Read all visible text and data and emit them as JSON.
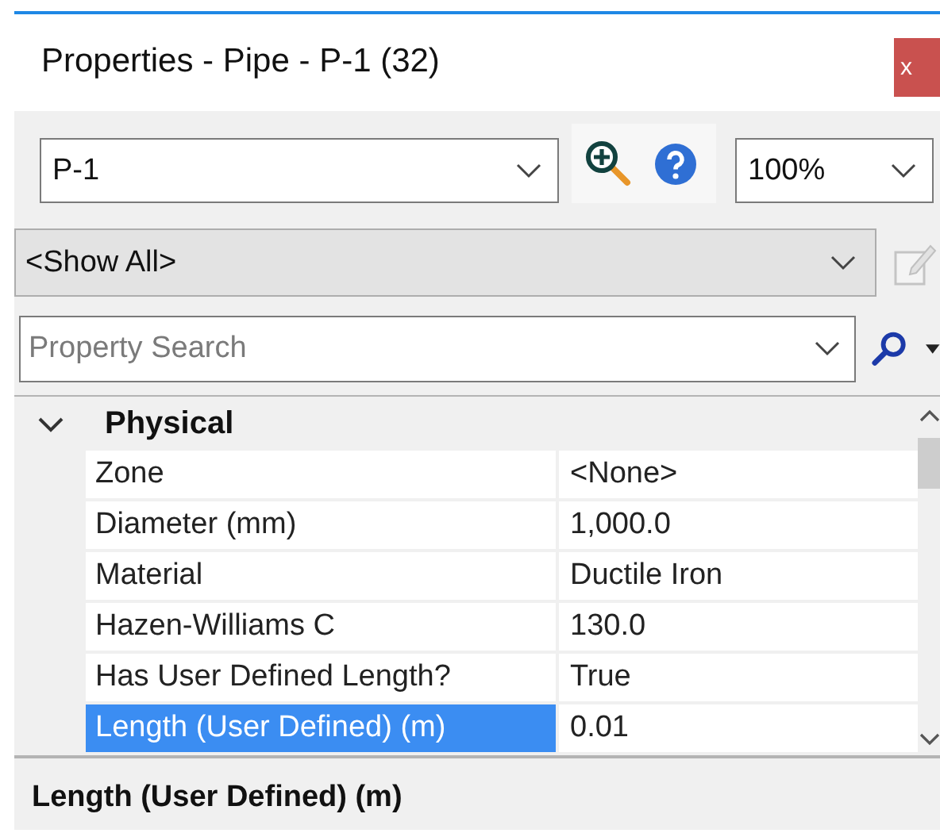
{
  "window": {
    "title": "Properties - Pipe - P-1 (32)",
    "close": "x"
  },
  "toolbar": {
    "element": {
      "value": "P-1"
    },
    "zoom": {
      "value": "100%"
    }
  },
  "filter": {
    "value": "<Show All>"
  },
  "search": {
    "placeholder": "Property Search"
  },
  "grid": {
    "categories": [
      {
        "label": "Physical",
        "expanded": true,
        "properties": [
          {
            "name": "Zone",
            "value": "<None>",
            "selected": false
          },
          {
            "name": "Diameter (mm)",
            "value": "1,000.0",
            "selected": false
          },
          {
            "name": "Material",
            "value": "Ductile Iron",
            "selected": false
          },
          {
            "name": "Hazen-Williams C",
            "value": "130.0",
            "selected": false
          },
          {
            "name": "Has User Defined Length?",
            "value": "True",
            "selected": false
          },
          {
            "name": "Length (User Defined) (m)",
            "value": "0.01",
            "selected": true
          }
        ]
      }
    ]
  },
  "description": {
    "title": "Length (User Defined) (m)"
  }
}
